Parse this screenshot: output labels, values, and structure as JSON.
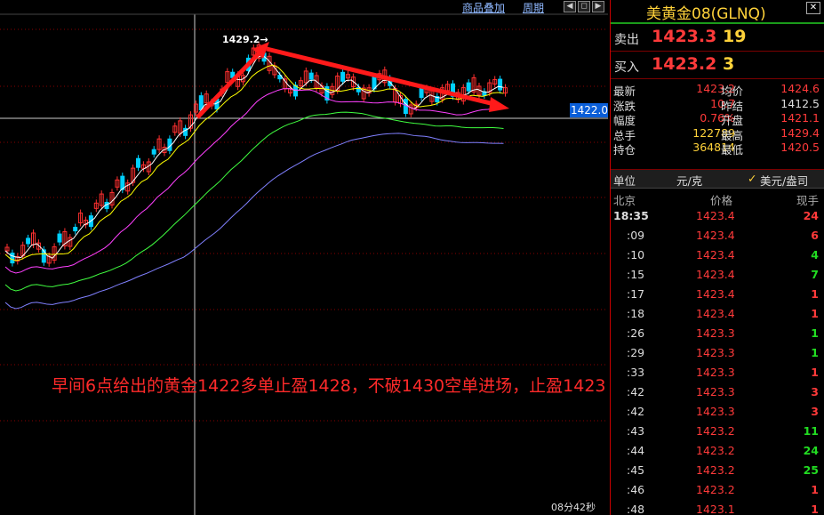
{
  "toolbar": {
    "overlay_link": "商品叠加",
    "period_link": "周期"
  },
  "chart": {
    "peak_label": "1429.2→",
    "current_price_tag": "1422.0",
    "timer": "08分42秒",
    "annotation": "早间6点给出的黄金1422多单止盈1428，不破1430空单进场，止盈1423",
    "colors": {
      "up": "#ff3030",
      "down": "#00d0ff",
      "ma5": "#ffffff",
      "ma10": "#ffff00",
      "ma20": "#ff40ff",
      "ma40": "#40ff40",
      "ma60": "#8080ff",
      "arrow": "#ff1a1a"
    }
  },
  "quote": {
    "title": "美黄金08(GLNQ)",
    "sell": {
      "label": "卖出",
      "price": "1423.3",
      "volume": "19"
    },
    "buy": {
      "label": "买入",
      "price": "1423.2",
      "volume": "3"
    },
    "stats": [
      {
        "l1": "最新",
        "v1": "1423.2",
        "c1": "#ff3a3a",
        "l2": "均价",
        "v2": "1424.6",
        "c2": "#ff3a3a"
      },
      {
        "l1": "涨跌",
        "v1": "10.7",
        "c1": "#ff3a3a",
        "l2": "昨结",
        "v2": "1412.5",
        "c2": "#dddddd"
      },
      {
        "l1": "幅度",
        "v1": "0.76%",
        "c1": "#ff3a3a",
        "l2": "开盘",
        "v2": "1421.1",
        "c2": "#ff3a3a"
      },
      {
        "l1": "总手",
        "v1": "122789",
        "c1": "#ffd23a",
        "l2": "最高",
        "v2": "1429.4",
        "c2": "#ff3a3a"
      },
      {
        "l1": "持仓",
        "v1": "364814",
        "c1": "#ffd23a",
        "l2": "最低",
        "v2": "1420.5",
        "c2": "#ff3a3a"
      }
    ],
    "unit": {
      "label": "单位",
      "value": "元/克",
      "check": "✓",
      "alt": "美元/盎司"
    },
    "ticks_header": {
      "time": "北京",
      "price": "价格",
      "volume": "现手"
    },
    "ticks": [
      {
        "time": "18:35",
        "price": "1423.4",
        "volume": "24",
        "color": "#ff3a3a"
      },
      {
        "time": ":09",
        "price": "1423.4",
        "volume": "6",
        "color": "#ff3a3a"
      },
      {
        "time": ":10",
        "price": "1423.4",
        "volume": "4",
        "color": "#22dd22"
      },
      {
        "time": ":15",
        "price": "1423.4",
        "volume": "7",
        "color": "#22dd22"
      },
      {
        "time": ":17",
        "price": "1423.4",
        "volume": "1",
        "color": "#ff3a3a"
      },
      {
        "time": ":18",
        "price": "1423.4",
        "volume": "1",
        "color": "#ff3a3a"
      },
      {
        "time": ":26",
        "price": "1423.3",
        "volume": "1",
        "color": "#22dd22"
      },
      {
        "time": ":29",
        "price": "1423.3",
        "volume": "1",
        "color": "#22dd22"
      },
      {
        "time": ":33",
        "price": "1423.3",
        "volume": "1",
        "color": "#ff3a3a"
      },
      {
        "time": ":42",
        "price": "1423.3",
        "volume": "3",
        "color": "#ff3a3a"
      },
      {
        "time": ":42",
        "price": "1423.3",
        "volume": "3",
        "color": "#ff3a3a"
      },
      {
        "time": ":43",
        "price": "1423.2",
        "volume": "11",
        "color": "#22dd22"
      },
      {
        "time": ":44",
        "price": "1423.2",
        "volume": "24",
        "color": "#22dd22"
      },
      {
        "time": ":45",
        "price": "1423.2",
        "volume": "25",
        "color": "#22dd22"
      },
      {
        "time": ":46",
        "price": "1423.2",
        "volume": "1",
        "color": "#ff3a3a"
      },
      {
        "time": ":48",
        "price": "1423.1",
        "volume": "1",
        "color": "#ff3a3a"
      }
    ]
  }
}
